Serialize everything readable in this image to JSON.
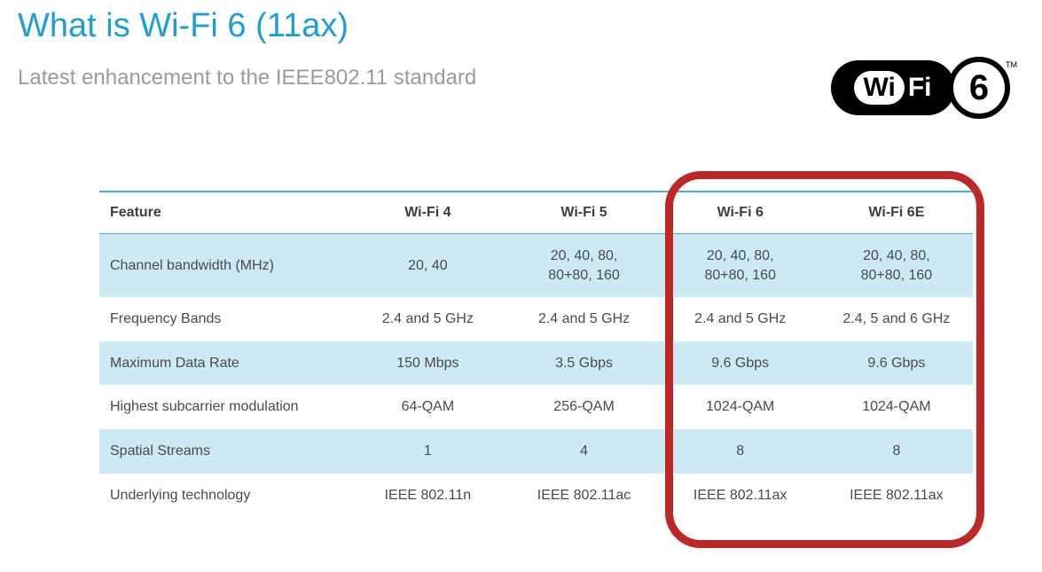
{
  "title": "What is Wi-Fi 6 (11ax)",
  "subtitle": "Latest enhancement to the IEEE802.11 standard",
  "logo": {
    "wi": "Wi",
    "fi": "Fi",
    "num": "6",
    "tm": "TM"
  },
  "table": {
    "headers": {
      "feature": "Feature",
      "c1": "Wi-Fi 4",
      "c2": "Wi-Fi 5",
      "c3": "Wi-Fi 6",
      "c4": "Wi-Fi 6E"
    },
    "rows": [
      {
        "feature": "Channel bandwidth (MHz)",
        "c1": "20, 40",
        "c2": "20, 40, 80,\n80+80, 160",
        "c3": "20, 40, 80,\n80+80, 160",
        "c4": "20, 40, 80,\n80+80, 160"
      },
      {
        "feature": "Frequency Bands",
        "c1": "2.4 and 5 GHz",
        "c2": "2.4 and 5 GHz",
        "c3": "2.4 and 5 GHz",
        "c4": "2.4, 5 and 6 GHz"
      },
      {
        "feature": "Maximum Data Rate",
        "c1": "150 Mbps",
        "c2": "3.5 Gbps",
        "c3": "9.6 Gbps",
        "c4": "9.6 Gbps"
      },
      {
        "feature": "Highest subcarrier modulation",
        "c1": "64-QAM",
        "c2": "256-QAM",
        "c3": "1024-QAM",
        "c4": "1024-QAM"
      },
      {
        "feature": "Spatial Streams",
        "c1": "1",
        "c2": "4",
        "c3": "8",
        "c4": "8"
      },
      {
        "feature": "Underlying technology",
        "c1": "IEEE 802.11n",
        "c2": "IEEE 802.11ac",
        "c3": "IEEE 802.11ax",
        "c4": "IEEE 802.11ax"
      }
    ]
  }
}
